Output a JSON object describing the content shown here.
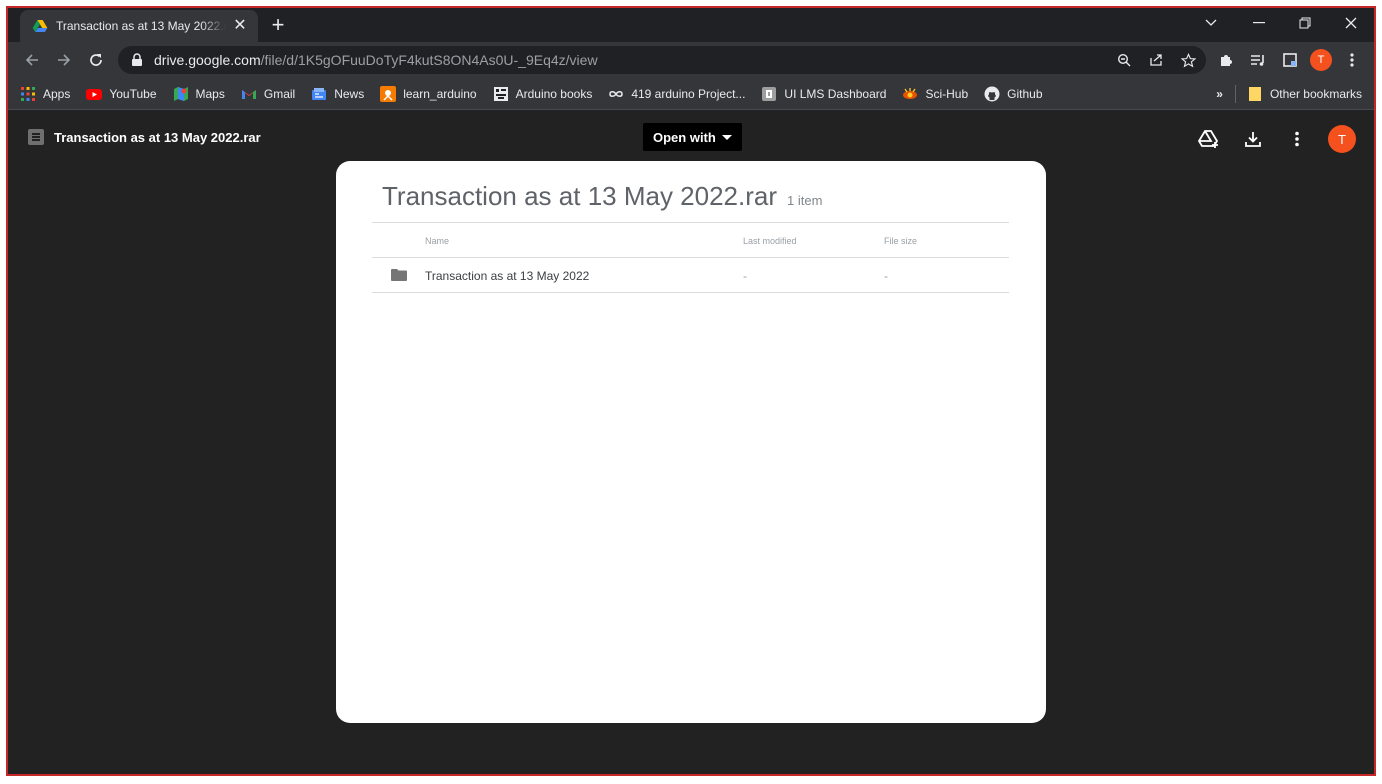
{
  "browser": {
    "tab": {
      "title": "Transaction as at 13 May 2022.rar",
      "favicon": "google-drive-icon"
    },
    "url": {
      "host": "drive.google.com",
      "path": "/file/d/1K5gOFuuDoTyF4kutS8ON4As0U-_9Eq4z/view"
    },
    "profile_initial": "T",
    "bookmarks": [
      {
        "label": "Apps",
        "icon": "apps-grid-icon"
      },
      {
        "label": "YouTube",
        "icon": "youtube-icon"
      },
      {
        "label": "Maps",
        "icon": "maps-icon"
      },
      {
        "label": "Gmail",
        "icon": "gmail-icon"
      },
      {
        "label": "News",
        "icon": "news-icon"
      },
      {
        "label": "learn_arduino",
        "icon": "arduino-icon"
      },
      {
        "label": "Arduino books",
        "icon": "book-icon"
      },
      {
        "label": "419 arduino Project...",
        "icon": "infinity-icon"
      },
      {
        "label": "UI LMS Dashboard",
        "icon": "lms-icon"
      },
      {
        "label": "Sci-Hub",
        "icon": "scihub-icon"
      },
      {
        "label": "Github",
        "icon": "github-icon"
      }
    ],
    "bookmarks_overflow": "»",
    "other_bookmarks": "Other bookmarks"
  },
  "viewer": {
    "file_name": "Transaction as at 13 May 2022.rar",
    "open_with": "Open with",
    "avatar_initial": "T",
    "card": {
      "title": "Transaction as at 13 May 2022.rar",
      "count": "1 item",
      "columns": {
        "name": "Name",
        "modified": "Last modified",
        "size": "File size"
      },
      "rows": [
        {
          "name": "Transaction as at 13 May 2022",
          "modified": "-",
          "size": "-",
          "type": "folder"
        }
      ]
    }
  },
  "colors": {
    "accent": "#f4511e",
    "frame": "#c62828"
  }
}
